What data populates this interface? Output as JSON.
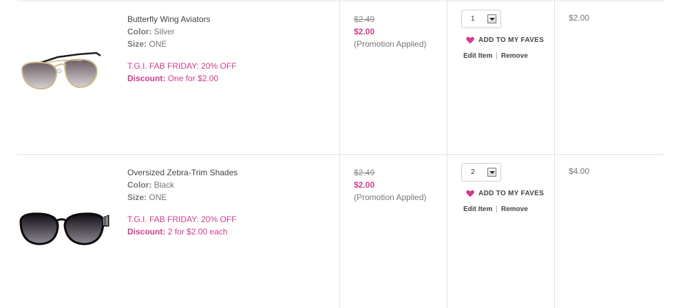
{
  "colors": {
    "accent": "#d23b8d",
    "border": "#e2e2e2",
    "text": "#555555"
  },
  "items": [
    {
      "name": "Butterfly Wing Aviators",
      "color_label": "Color:",
      "color_value": "Silver",
      "size_label": "Size:",
      "size_value": "ONE",
      "promo": "T.G.I. FAB FRIDAY: 20% OFF",
      "discount_label": "Discount:",
      "discount_value": "One for $2.00",
      "original_price": "$2.49",
      "sale_price": "$2.00",
      "promo_note": "(Promotion Applied)",
      "quantity": "1",
      "faves_label": "ADD TO MY FAVES",
      "edit_label": "Edit Item",
      "separator": "|",
      "remove_label": "Remove",
      "total": "$2.00",
      "image_icon": "aviator-sunglasses-icon"
    },
    {
      "name": "Oversized Zebra-Trim Shades",
      "color_label": "Color:",
      "color_value": "Black",
      "size_label": "Size:",
      "size_value": "ONE",
      "promo": "T.G.I. FAB FRIDAY: 20% OFF",
      "discount_label": "Discount:",
      "discount_value": "2 for $2.00 each",
      "original_price": "$2.49",
      "sale_price": "$2.00",
      "promo_note": "(Promotion Applied)",
      "quantity": "2",
      "faves_label": "ADD TO MY FAVES",
      "edit_label": "Edit Item",
      "separator": "|",
      "remove_label": "Remove",
      "total": "$4.00",
      "image_icon": "oversized-sunglasses-icon"
    }
  ]
}
